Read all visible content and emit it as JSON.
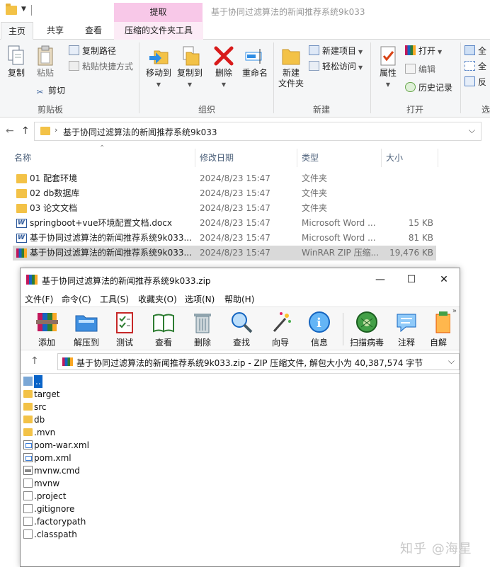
{
  "explorer": {
    "context_tab": "提取",
    "window_title": "基于协同过滤算法的新闻推荐系统9k033",
    "tabs": [
      "主页",
      "共享",
      "查看",
      "压缩的文件夹工具"
    ],
    "ribbon": {
      "clipboard": {
        "copy": "复制",
        "paste": "粘贴",
        "copy_path": "复制路径",
        "paste_shortcut": "粘贴快捷方式",
        "cut": "剪切",
        "group": "剪贴板"
      },
      "organize": {
        "move_to": "移动到",
        "copy_to": "复制到",
        "delete": "删除",
        "rename": "重命名",
        "group": "组织"
      },
      "new": {
        "new_folder": "新建\n文件夹",
        "new_item": "新建项目",
        "easy_access": "轻松访问",
        "group": "新建"
      },
      "open": {
        "properties": "属性",
        "open": "打开",
        "edit": "编辑",
        "history": "历史记录",
        "group": "打开"
      },
      "select": {
        "select_all": "全",
        "select_none": "全",
        "invert": "反",
        "group": "选"
      }
    },
    "address": "基于协同过滤算法的新闻推荐系统9k033",
    "columns": {
      "name": "名称",
      "date": "修改日期",
      "type": "类型",
      "size": "大小"
    },
    "files": [
      {
        "name": "01 配套环境",
        "date": "2024/8/23 15:47",
        "type": "文件夹",
        "size": "",
        "icon": "folder-icon"
      },
      {
        "name": "02 db数据库",
        "date": "2024/8/23 15:47",
        "type": "文件夹",
        "size": "",
        "icon": "folder-icon"
      },
      {
        "name": "03 论文文档",
        "date": "2024/8/23 15:47",
        "type": "文件夹",
        "size": "",
        "icon": "folder-icon"
      },
      {
        "name": "springboot+vue环境配置文档.docx",
        "date": "2024/8/23 15:47",
        "type": "Microsoft Word ...",
        "size": "15 KB",
        "icon": "word-doc-icon"
      },
      {
        "name": "基于协同过滤算法的新闻推荐系统9k033...",
        "date": "2024/8/23 15:47",
        "type": "Microsoft Word ...",
        "size": "81 KB",
        "icon": "word-doc-icon"
      },
      {
        "name": "基于协同过滤算法的新闻推荐系统9k033...",
        "date": "2024/8/23 15:47",
        "type": "WinRAR ZIP 压缩...",
        "size": "19,476 KB",
        "icon": "winrar-archive-icon"
      }
    ]
  },
  "winrar": {
    "title": "基于协同过滤算法的新闻推荐系统9k033.zip",
    "menu": [
      "文件(F)",
      "命令(C)",
      "工具(S)",
      "收藏夹(O)",
      "选项(N)",
      "帮助(H)"
    ],
    "toolbar": [
      "添加",
      "解压到",
      "测试",
      "查看",
      "删除",
      "查找",
      "向导",
      "信息",
      "扫描病毒",
      "注释",
      "自解"
    ],
    "path": "基于协同过滤算法的新闻推荐系统9k033.zip - ZIP 压缩文件, 解包大小为 40,387,574 字节",
    "items": [
      {
        "name": "..",
        "kind": "up"
      },
      {
        "name": "target",
        "kind": "fold"
      },
      {
        "name": "src",
        "kind": "fold"
      },
      {
        "name": "db",
        "kind": "fold"
      },
      {
        "name": ".mvn",
        "kind": "fold"
      },
      {
        "name": "pom-war.xml",
        "kind": "xml"
      },
      {
        "name": "pom.xml",
        "kind": "xml"
      },
      {
        "name": "mvnw.cmd",
        "kind": "cmd"
      },
      {
        "name": "mvnw",
        "kind": "doc"
      },
      {
        "name": ".project",
        "kind": "doc"
      },
      {
        "name": ".gitignore",
        "kind": "doc"
      },
      {
        "name": ".factorypath",
        "kind": "doc"
      },
      {
        "name": ".classpath",
        "kind": "doc"
      }
    ]
  },
  "watermark": "知乎 @海星"
}
